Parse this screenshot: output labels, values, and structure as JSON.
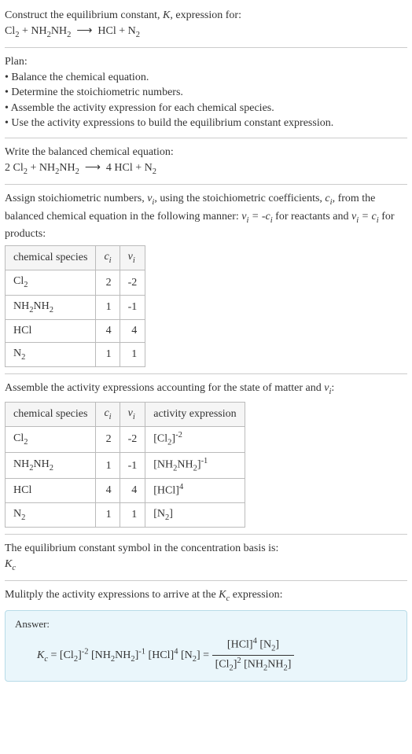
{
  "header": {
    "line1": "Construct the equilibrium constant, ",
    "K": "K",
    "line1_end": ", expression for:",
    "equation": "Cl₂ + NH₂NH₂ ⟶ HCl + N₂"
  },
  "plan": {
    "title": "Plan:",
    "items": [
      "• Balance the chemical equation.",
      "• Determine the stoichiometric numbers.",
      "• Assemble the activity expression for each chemical species.",
      "• Use the activity expressions to build the equilibrium constant expression."
    ]
  },
  "balanced": {
    "intro": "Write the balanced chemical equation:",
    "equation": "2 Cl₂ + NH₂NH₂ ⟶ 4 HCl + N₂"
  },
  "stoich": {
    "intro_a": "Assign stoichiometric numbers, ",
    "nu": "ν",
    "sub_i": "i",
    "intro_b": ", using the stoichiometric coefficients, ",
    "c": "c",
    "intro_c": ", from the balanced chemical equation in the following manner: ",
    "rel1": "νᵢ = -cᵢ",
    "intro_d": " for reactants and ",
    "rel2": "νᵢ = cᵢ",
    "intro_e": " for products:",
    "headers": [
      "chemical species",
      "cᵢ",
      "νᵢ"
    ],
    "rows": [
      {
        "species": "Cl₂",
        "c": "2",
        "nu": "-2"
      },
      {
        "species": "NH₂NH₂",
        "c": "1",
        "nu": "-1"
      },
      {
        "species": "HCl",
        "c": "4",
        "nu": "4"
      },
      {
        "species": "N₂",
        "c": "1",
        "nu": "1"
      }
    ]
  },
  "activity": {
    "intro_a": "Assemble the activity expressions accounting for the state of matter and ",
    "intro_b": ":",
    "headers": [
      "chemical species",
      "cᵢ",
      "νᵢ",
      "activity expression"
    ],
    "rows": [
      {
        "species": "Cl₂",
        "c": "2",
        "nu": "-2",
        "expr": "[Cl₂]⁻²"
      },
      {
        "species": "NH₂NH₂",
        "c": "1",
        "nu": "-1",
        "expr": "[NH₂NH₂]⁻¹"
      },
      {
        "species": "HCl",
        "c": "4",
        "nu": "4",
        "expr": "[HCl]⁴"
      },
      {
        "species": "N₂",
        "c": "1",
        "nu": "1",
        "expr": "[N₂]"
      }
    ]
  },
  "symbol": {
    "intro": "The equilibrium constant symbol in the concentration basis is:",
    "Kc": "K",
    "Kc_sub": "c"
  },
  "multiply": {
    "intro_a": "Mulitply the activity expressions to arrive at the ",
    "intro_b": " expression:"
  },
  "answer": {
    "label": "Answer:",
    "lhs": "Kc = [Cl₂]⁻² [NH₂NH₂]⁻¹ [HCl]⁴ [N₂] = ",
    "frac_num": "[HCl]⁴ [N₂]",
    "frac_den": "[Cl₂]² [NH₂NH₂]"
  },
  "chart_data": {
    "type": "table",
    "tables": [
      {
        "title": "stoichiometric numbers",
        "columns": [
          "chemical species",
          "c_i",
          "nu_i"
        ],
        "rows": [
          [
            "Cl2",
            2,
            -2
          ],
          [
            "NH2NH2",
            1,
            -1
          ],
          [
            "HCl",
            4,
            4
          ],
          [
            "N2",
            1,
            1
          ]
        ]
      },
      {
        "title": "activity expressions",
        "columns": [
          "chemical species",
          "c_i",
          "nu_i",
          "activity expression"
        ],
        "rows": [
          [
            "Cl2",
            2,
            -2,
            "[Cl2]^-2"
          ],
          [
            "NH2NH2",
            1,
            -1,
            "[NH2NH2]^-1"
          ],
          [
            "HCl",
            4,
            4,
            "[HCl]^4"
          ],
          [
            "N2",
            1,
            1,
            "[N2]"
          ]
        ]
      }
    ]
  }
}
